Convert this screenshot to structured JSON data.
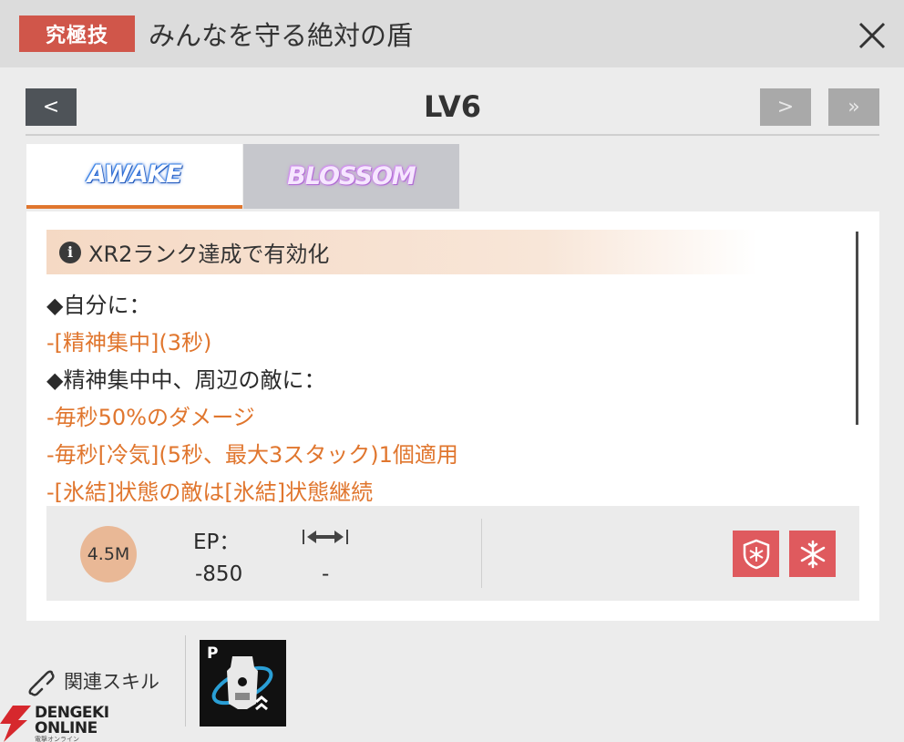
{
  "header": {
    "badge": "究極技",
    "title": "みんなを守る絶対の盾",
    "close_icon": "close-icon"
  },
  "level": {
    "label": "LV6",
    "prev": "<",
    "next": ">",
    "max": "»"
  },
  "tabs": [
    {
      "label": "AWAKE",
      "active": true
    },
    {
      "label": "BLOSSOM",
      "active": false
    }
  ],
  "description": {
    "notice": "XR2ランク達成で有効化",
    "info_icon": "i",
    "lines": [
      {
        "text": "◆自分に：",
        "style": "dark"
      },
      {
        "text": "-[精神集中](3秒)",
        "style": "orange"
      },
      {
        "text": "◆精神集中中、周辺の敵に：",
        "style": "dark"
      },
      {
        "text": "-毎秒50%のダメージ",
        "style": "orange"
      },
      {
        "text": "-毎秒[冷気](5秒、最大3スタック)1個適用",
        "style": "orange"
      },
      {
        "text": "-[氷結]状態の敵は[氷結]状態継続",
        "style": "orange"
      }
    ]
  },
  "stats": {
    "cost": "4.5M",
    "ep_label": "EP：",
    "ep_value": "-850",
    "range_icon": "range-arrows-icon",
    "range_value": "-",
    "effect_icons": [
      "frost-shield-icon",
      "snowflake-icon"
    ],
    "effect_color": "#df5a5e"
  },
  "related": {
    "label": "関連スキル",
    "skill_badge": "P"
  },
  "watermark": {
    "line1": "DENGEKI",
    "line2": "ONLINE",
    "line3": "電撃オンライン"
  }
}
